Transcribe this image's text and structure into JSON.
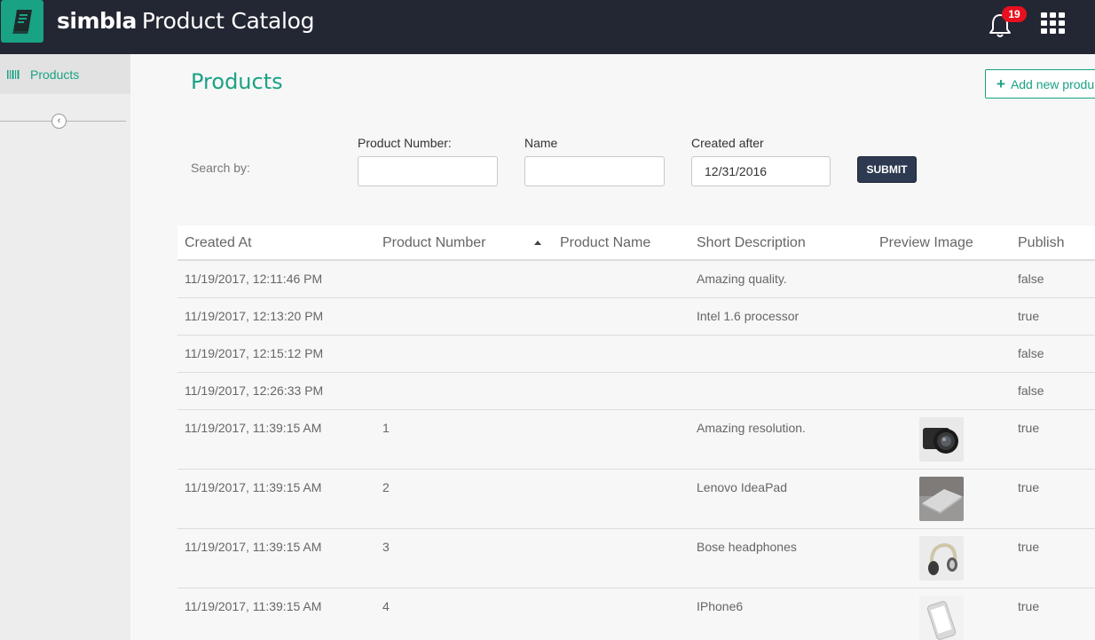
{
  "header": {
    "brand_logo": "simbla",
    "app_title": "Product Catalog",
    "notification_count": "19"
  },
  "sidebar": {
    "items": [
      {
        "label": "Products",
        "icon": "barcode-icon"
      }
    ]
  },
  "main": {
    "title": "Products",
    "add_button_label": "Add new produ",
    "search": {
      "label": "Search by:",
      "product_number_label": "Product Number:",
      "product_number_value": "",
      "name_label": "Name",
      "name_value": "",
      "created_after_label": "Created after",
      "created_after_value": "12/31/2016",
      "submit_label": "SUBMIT"
    },
    "table": {
      "columns": [
        "Created At",
        "Product Number",
        "Product Name",
        "Short Description",
        "Preview Image",
        "Publish"
      ],
      "sorted_column": "Product Number",
      "sort_direction": "ascending",
      "rows": [
        {
          "created_at": "11/19/2017, 12:11:46 PM",
          "product_number": "",
          "product_name": "",
          "short_description": "Amazing quality.",
          "preview_image": "",
          "publish": "false"
        },
        {
          "created_at": "11/19/2017, 12:13:20 PM",
          "product_number": "",
          "product_name": "",
          "short_description": "Intel 1.6 processor",
          "preview_image": "",
          "publish": "true"
        },
        {
          "created_at": "11/19/2017, 12:15:12 PM",
          "product_number": "",
          "product_name": "",
          "short_description": "",
          "preview_image": "",
          "publish": "false"
        },
        {
          "created_at": "11/19/2017, 12:26:33 PM",
          "product_number": "",
          "product_name": "",
          "short_description": "",
          "preview_image": "",
          "publish": "false"
        },
        {
          "created_at": "11/19/2017, 11:39:15 AM",
          "product_number": "1",
          "product_name": "",
          "short_description": "Amazing resolution.",
          "preview_image": "camera-photo",
          "publish": "true"
        },
        {
          "created_at": "11/19/2017, 11:39:15 AM",
          "product_number": "2",
          "product_name": "",
          "short_description": "Lenovo IdeaPad",
          "preview_image": "laptop-photo",
          "publish": "true"
        },
        {
          "created_at": "11/19/2017, 11:39:15 AM",
          "product_number": "3",
          "product_name": "",
          "short_description": "Bose headphones",
          "preview_image": "headphones-photo",
          "publish": "true"
        },
        {
          "created_at": "11/19/2017, 11:39:15 AM",
          "product_number": "4",
          "product_name": "",
          "short_description": "IPhone6",
          "preview_image": "phone-photo",
          "publish": "true"
        }
      ]
    }
  },
  "colors": {
    "accent": "#1aa285",
    "topbar": "#232633",
    "submit": "#2d3a52",
    "badge": "#e8101e"
  }
}
